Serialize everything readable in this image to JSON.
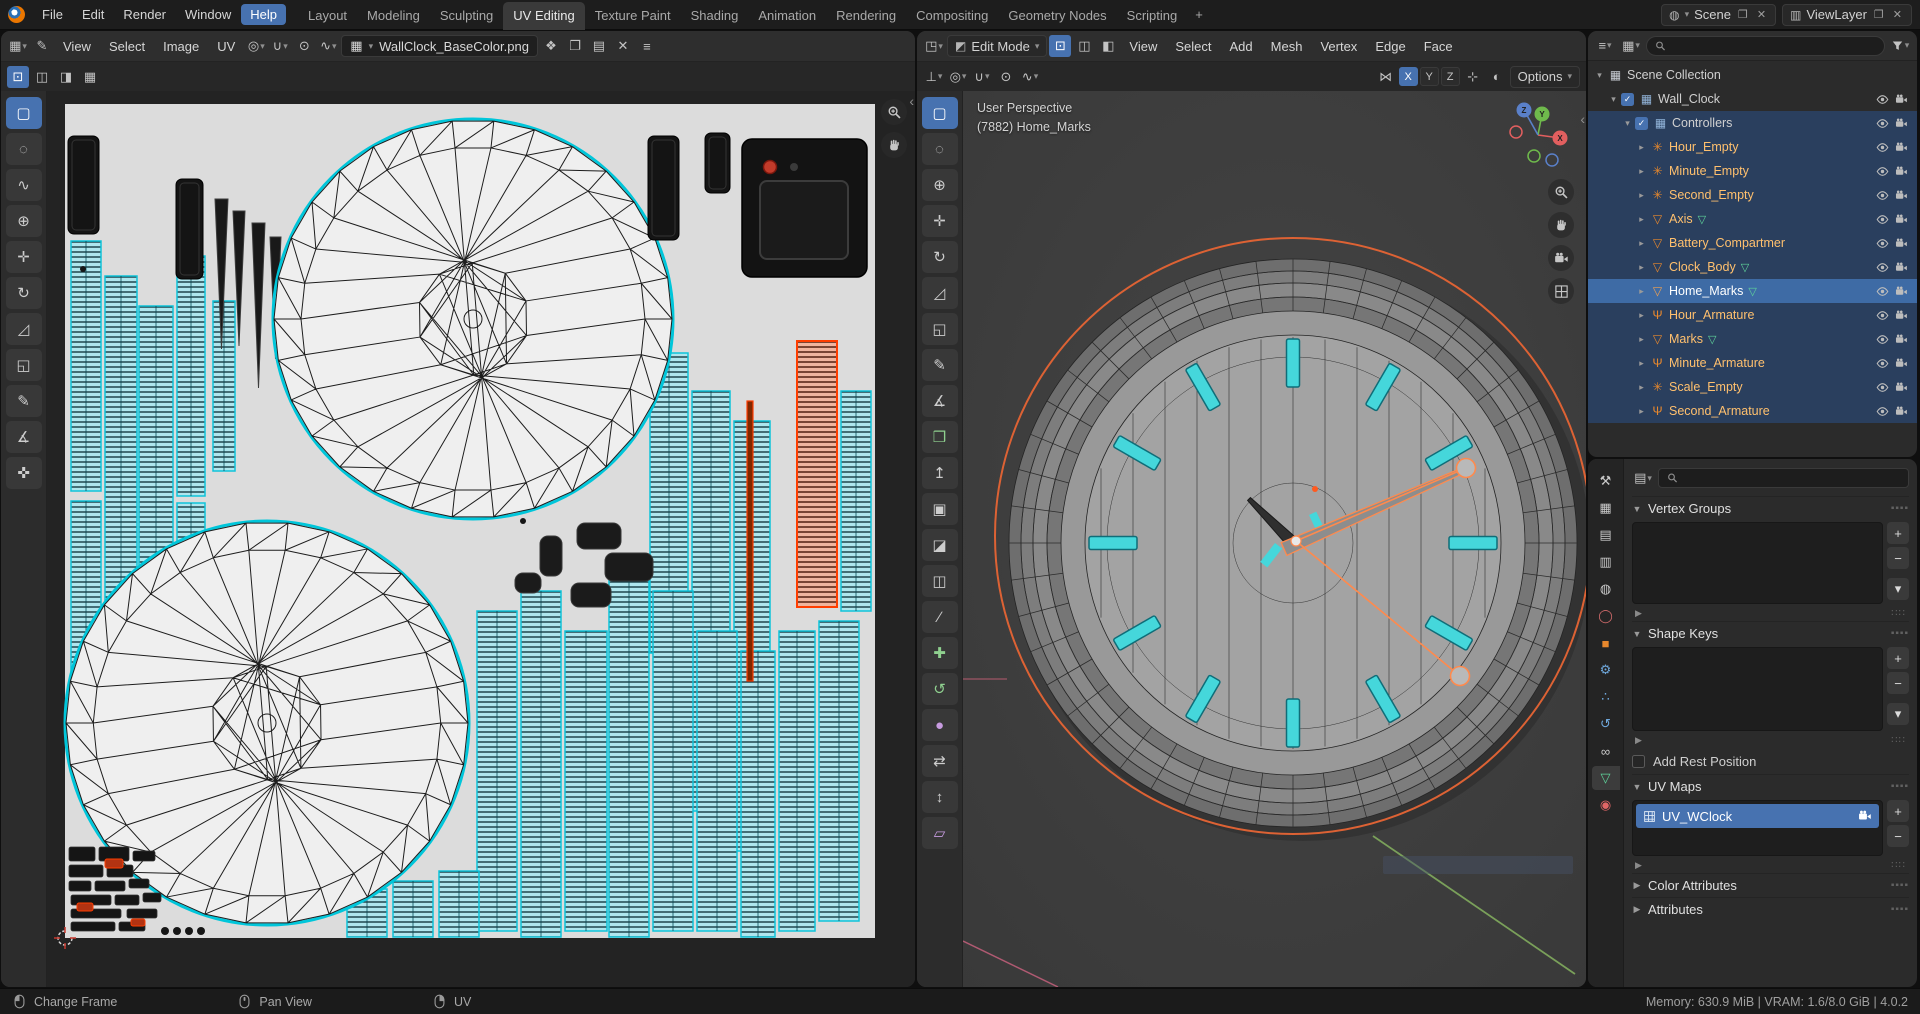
{
  "colors": {
    "accent": "#4772b0",
    "selection_row": "#2a3f5e",
    "active_row": "#3e6ba5",
    "uv_cyan": "#0fc4da",
    "object_orange": "#e8882d",
    "selected_red": "#ff3d00",
    "data_green": "#5fd39a"
  },
  "topbar": {
    "menus": [
      "File",
      "Edit",
      "Render",
      "Window",
      "Help"
    ],
    "highlighted_menu": "Help",
    "workspaces": [
      "Layout",
      "Modeling",
      "Sculpting",
      "UV Editing",
      "Texture Paint",
      "Shading",
      "Animation",
      "Rendering",
      "Compositing",
      "Geometry Nodes",
      "Scripting"
    ],
    "active_workspace": "UV Editing",
    "add_workspace_label": "+",
    "scene": {
      "label": "Scene"
    },
    "view_layer": {
      "label": "ViewLayer"
    }
  },
  "uv_editor": {
    "menus": [
      "View",
      "Select",
      "Image",
      "UV"
    ],
    "image_name": "WallClock_BaseColor.png",
    "row1_tools": [
      {
        "name": "annotate-pen",
        "glyph": "✎"
      }
    ],
    "header_icons": [
      {
        "name": "pivot-point",
        "glyph": "◎",
        "drop": true
      },
      {
        "name": "snapping",
        "glyph": "∪",
        "drop": true
      },
      {
        "name": "proportional-editing",
        "glyph": "⊙",
        "drop": false
      },
      {
        "name": "proportional-falloff",
        "glyph": "∿",
        "drop": true
      }
    ],
    "image_side_icons": [
      {
        "name": "fake-user",
        "glyph": "❖"
      },
      {
        "name": "new-image",
        "glyph": "❐"
      },
      {
        "name": "open-image",
        "glyph": "▤"
      },
      {
        "name": "unlink-image",
        "glyph": "✕"
      },
      {
        "name": "image-menu",
        "glyph": "≡"
      }
    ],
    "select_modes": [
      {
        "name": "uv-select-vertex",
        "glyph": "⊡",
        "active": true
      },
      {
        "name": "uv-select-edge",
        "glyph": "◫",
        "active": false
      },
      {
        "name": "uv-select-face",
        "glyph": "◨",
        "active": false
      },
      {
        "name": "uv-select-island",
        "glyph": "▦",
        "active": false
      }
    ],
    "toolbar": [
      {
        "name": "select-box",
        "glyph": "▢",
        "active": true
      },
      {
        "name": "select-circle",
        "glyph": "◌"
      },
      {
        "name": "select-lasso",
        "glyph": "∿"
      },
      {
        "name": "cursor-2d",
        "glyph": "⊕"
      },
      {
        "name": "move",
        "glyph": "✛"
      },
      {
        "name": "rotate",
        "glyph": "↻"
      },
      {
        "name": "scale",
        "glyph": "◿"
      },
      {
        "name": "transform",
        "glyph": "◱"
      },
      {
        "name": "annotate",
        "glyph": "✎"
      },
      {
        "name": "measure",
        "glyph": "∡"
      },
      {
        "name": "grab",
        "glyph": "✜"
      }
    ]
  },
  "viewport": {
    "mode_label": "Edit Mode",
    "menus": [
      "View",
      "Select",
      "Add",
      "Mesh",
      "Vertex",
      "Edge",
      "Face"
    ],
    "select_modes": [
      {
        "name": "vertex-select-mode",
        "glyph": "⊡",
        "active": true
      },
      {
        "name": "edge-select-mode",
        "glyph": "◫",
        "active": false
      },
      {
        "name": "face-select-mode",
        "glyph": "◧",
        "active": false
      }
    ],
    "row2_left": [
      {
        "name": "transform-orientation",
        "glyph": "⊥",
        "drop": true
      },
      {
        "name": "pivot-point",
        "glyph": "◎",
        "drop": true
      },
      {
        "name": "snapping",
        "glyph": "∪",
        "drop": true
      },
      {
        "name": "proportional-editing",
        "glyph": "⊙",
        "drop": false
      },
      {
        "name": "proportional-falloff",
        "glyph": "∿",
        "drop": true
      }
    ],
    "mirror": {
      "icon": "⋈",
      "axes": [
        "X",
        "Y",
        "Z"
      ],
      "active_axis": "X"
    },
    "post_icons": [
      {
        "name": "snap-indicator",
        "glyph": "⊹"
      },
      {
        "name": "overlays",
        "glyph": "◐"
      }
    ],
    "options_label": "Options",
    "overlay": {
      "line1": "User Perspective",
      "line2": "(7882) Home_Marks"
    },
    "gizmo_axes": [
      "X",
      "Y",
      "Z"
    ],
    "toolbar": [
      {
        "name": "select-box",
        "glyph": "▢",
        "active": true
      },
      {
        "name": "select-circle",
        "glyph": "◌"
      },
      {
        "name": "cursor-3d",
        "glyph": "⊕"
      },
      {
        "name": "move",
        "glyph": "✛"
      },
      {
        "name": "rotate",
        "glyph": "↻"
      },
      {
        "name": "scale",
        "glyph": "◿"
      },
      {
        "name": "transform",
        "glyph": "◱"
      },
      {
        "name": "annotate",
        "glyph": "✎"
      },
      {
        "name": "measure",
        "glyph": "∡"
      },
      {
        "name": "add-cube",
        "glyph": "❒",
        "color": "#8fd08f"
      },
      {
        "name": "extrude-region",
        "glyph": "↥"
      },
      {
        "name": "inset-faces",
        "glyph": "▣"
      },
      {
        "name": "bevel",
        "glyph": "◪"
      },
      {
        "name": "loop-cut",
        "glyph": "◫"
      },
      {
        "name": "knife",
        "glyph": "∕"
      },
      {
        "name": "poly-build",
        "glyph": "✚",
        "color": "#8fd08f"
      },
      {
        "name": "spin",
        "glyph": "↺",
        "color": "#8fd08f"
      },
      {
        "name": "smooth",
        "glyph": "●",
        "color": "#c79be0"
      },
      {
        "name": "edge-slide",
        "glyph": "⇄"
      },
      {
        "name": "shrink-fatten",
        "glyph": "↕"
      },
      {
        "name": "shear",
        "glyph": "▱",
        "color": "#c79be0"
      }
    ]
  },
  "outliner": {
    "search_placeholder": "",
    "rows": [
      {
        "label": "Scene Collection",
        "depth": 0,
        "arrow": "open",
        "icon": "collection",
        "icon_color": "#c8cdd4",
        "checkbox": false,
        "badge": false,
        "eye": false,
        "camera": false,
        "state": "none"
      },
      {
        "label": "Wall_Clock",
        "depth": 1,
        "arrow": "open",
        "icon": "collection",
        "icon_color": "#91b3d8",
        "checkbox": true,
        "badge": false,
        "eye": true,
        "camera": true,
        "state": "none"
      },
      {
        "label": "Controllers",
        "depth": 2,
        "arrow": "open",
        "icon": "collection",
        "icon_color": "#91b3d8",
        "checkbox": true,
        "badge": false,
        "eye": true,
        "camera": true,
        "state": "selected"
      },
      {
        "label": "Hour_Empty",
        "depth": 3,
        "arrow": "closed",
        "icon": "empty",
        "icon_color": "#e8882d",
        "checkbox": false,
        "badge": false,
        "eye": true,
        "camera": true,
        "state": "selected"
      },
      {
        "label": "Minute_Empty",
        "depth": 3,
        "arrow": "closed",
        "icon": "empty",
        "icon_color": "#e8882d",
        "checkbox": false,
        "badge": false,
        "eye": true,
        "camera": true,
        "state": "selected"
      },
      {
        "label": "Second_Empty",
        "depth": 3,
        "arrow": "closed",
        "icon": "empty",
        "icon_color": "#e8882d",
        "checkbox": false,
        "badge": false,
        "eye": true,
        "camera": true,
        "state": "selected"
      },
      {
        "label": "Axis",
        "depth": 3,
        "arrow": "closed",
        "icon": "mesh",
        "icon_color": "#e8882d",
        "checkbox": false,
        "badge": true,
        "eye": true,
        "camera": true,
        "state": "selected"
      },
      {
        "label": "Battery_Compartmer",
        "depth": 3,
        "arrow": "closed",
        "icon": "mesh",
        "icon_color": "#e8882d",
        "checkbox": false,
        "badge": false,
        "eye": true,
        "camera": true,
        "state": "selected"
      },
      {
        "label": "Clock_Body",
        "depth": 3,
        "arrow": "closed",
        "icon": "mesh",
        "icon_color": "#e8882d",
        "checkbox": false,
        "badge": true,
        "eye": true,
        "camera": true,
        "state": "selected"
      },
      {
        "label": "Home_Marks",
        "depth": 3,
        "arrow": "closed",
        "icon": "mesh",
        "icon_color": "#f0a050",
        "checkbox": false,
        "badge": true,
        "eye": true,
        "camera": true,
        "state": "active"
      },
      {
        "label": "Hour_Armature",
        "depth": 3,
        "arrow": "closed",
        "icon": "armature",
        "icon_color": "#e8882d",
        "checkbox": false,
        "badge": false,
        "eye": true,
        "camera": true,
        "state": "selected"
      },
      {
        "label": "Marks",
        "depth": 3,
        "arrow": "closed",
        "icon": "mesh",
        "icon_color": "#e8882d",
        "checkbox": false,
        "badge": true,
        "eye": true,
        "camera": true,
        "state": "selected"
      },
      {
        "label": "Minute_Armature",
        "depth": 3,
        "arrow": "closed",
        "icon": "armature",
        "icon_color": "#e8882d",
        "checkbox": false,
        "badge": false,
        "eye": true,
        "camera": true,
        "state": "selected"
      },
      {
        "label": "Scale_Empty",
        "depth": 3,
        "arrow": "closed",
        "icon": "empty",
        "icon_color": "#e8882d",
        "checkbox": false,
        "badge": false,
        "eye": true,
        "camera": true,
        "state": "selected"
      },
      {
        "label": "Second_Armature",
        "depth": 3,
        "arrow": "closed",
        "icon": "armature",
        "icon_color": "#e8882d",
        "checkbox": false,
        "badge": false,
        "eye": true,
        "camera": true,
        "state": "selected"
      }
    ]
  },
  "properties": {
    "search_placeholder": "",
    "tabs": [
      {
        "name": "tool",
        "glyph": "⚒",
        "color": "#c9c9c9",
        "active": false
      },
      {
        "name": "render",
        "glyph": "▦",
        "color": "#c9c9c9",
        "active": false
      },
      {
        "name": "output",
        "glyph": "▤",
        "color": "#c9c9c9",
        "active": false
      },
      {
        "name": "view-layer",
        "glyph": "▥",
        "color": "#c9c9c9",
        "active": false
      },
      {
        "name": "scene",
        "glyph": "◍",
        "color": "#c9c9c9",
        "active": false
      },
      {
        "name": "world",
        "glyph": "◯",
        "color": "#d06a6a",
        "active": false
      },
      {
        "name": "object",
        "glyph": "■",
        "color": "#e8882d",
        "active": false
      },
      {
        "name": "modifiers",
        "glyph": "⚙",
        "color": "#6fa8dc",
        "active": false
      },
      {
        "name": "particles",
        "glyph": "∴",
        "color": "#6fa8dc",
        "active": false
      },
      {
        "name": "physics",
        "glyph": "↺",
        "color": "#6fa8dc",
        "active": false
      },
      {
        "name": "constraints",
        "glyph": "∞",
        "color": "#c9c9c9",
        "active": false
      },
      {
        "name": "object-data",
        "glyph": "▽",
        "color": "#5fd39a",
        "active": true
      },
      {
        "name": "material",
        "glyph": "◉",
        "color": "#e06666",
        "active": false
      }
    ],
    "vertex_groups_title": "Vertex Groups",
    "shape_keys_title": "Shape Keys",
    "add_rest_position_label": "Add Rest Position",
    "uv_maps_title": "UV Maps",
    "uv_map_item": {
      "name": "UV_WClock"
    },
    "color_attributes_title": "Color Attributes",
    "attributes_title": "Attributes",
    "list_buttons": {
      "add": "+",
      "remove": "−",
      "menu": "▾"
    }
  },
  "statusbar": {
    "hints": [
      {
        "icon": "mouse-left",
        "label": "Change Frame"
      },
      {
        "icon": "mouse-middle",
        "label": "Pan View"
      },
      {
        "icon": "mouse-right",
        "label": "UV"
      }
    ],
    "stats": "Memory: 630.9 MiB  |  VRAM: 1.6/8.0 GiB  |  4.0.2"
  }
}
